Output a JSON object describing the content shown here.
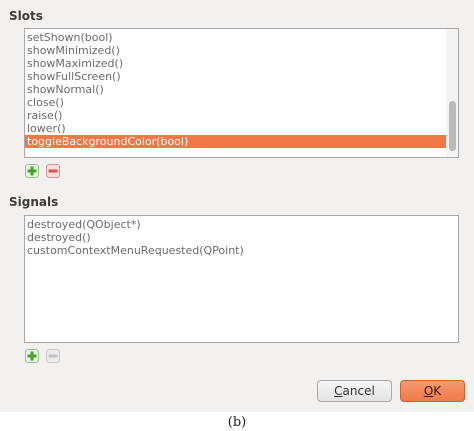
{
  "slots": {
    "title": "Slots",
    "items": [
      "setShown(bool)",
      "showMinimized()",
      "showMaximized()",
      "showFullScreen()",
      "showNormal()",
      "close()",
      "raise()",
      "lower()",
      "toggleBackgroundColor(bool)"
    ],
    "selected_index": 8
  },
  "signals": {
    "title": "Signals",
    "items": [
      "destroyed(QObject*)",
      "destroyed()",
      "customContextMenuRequested(QPoint)"
    ]
  },
  "buttons": {
    "cancel_label": "Cancel",
    "cancel_mnemonic": "C",
    "ok_label": "OK",
    "ok_mnemonic": "O"
  },
  "icons": {
    "add": "plus-icon",
    "remove": "minus-icon"
  },
  "colors": {
    "selection": "#f07746",
    "add_green": "#4aa02c",
    "remove_red": "#d9534f"
  },
  "caption": "(b)"
}
